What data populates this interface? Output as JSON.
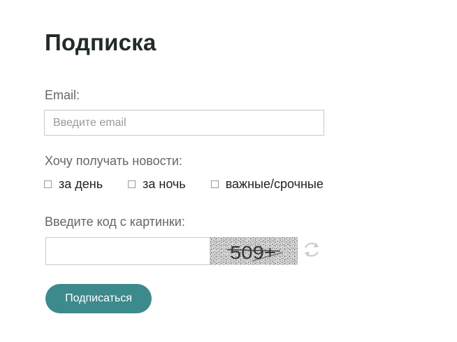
{
  "form": {
    "title": "Подписка",
    "email_label": "Email:",
    "email_placeholder": "Введите email",
    "email_value": "",
    "news_label": "Хочу получать новости:",
    "options": [
      {
        "label": "за день",
        "checked": false
      },
      {
        "label": "за ночь",
        "checked": false
      },
      {
        "label": "важные/срочные",
        "checked": false
      }
    ],
    "captcha_label": "Введите код с картинки:",
    "captcha_value": "",
    "captcha_image_text": "509+",
    "refresh_icon": "refresh-icon",
    "submit_label": "Подписаться"
  },
  "colors": {
    "title": "#232a2a",
    "label": "#666666",
    "button_bg": "#3d8a8c",
    "button_text": "#ffffff",
    "input_border": "#c9c9c9"
  }
}
